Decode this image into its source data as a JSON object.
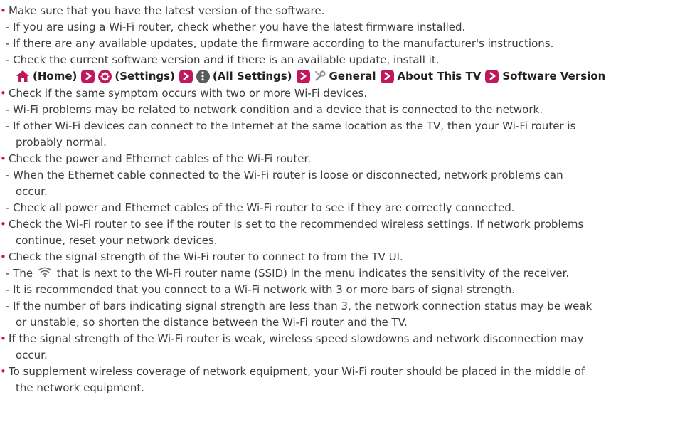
{
  "lines": {
    "l1": "Make sure that you have the latest version of the software.",
    "l2": "- If you are using a Wi-Fi router, check whether you have the latest firmware installed.",
    "l3": "- If there are any available updates, update the firmware according to the manufacturer's instructions.",
    "l4": "- Check the current software version and if there is an available update, install it.",
    "l6": "Check if the same symptom occurs with two or more Wi-Fi devices.",
    "l7": "- Wi-Fi problems may be related to network condition and a device that is connected to the network.",
    "l8": "- If other Wi-Fi devices can connect to the Internet at the same location as the TV, then your Wi-Fi router is",
    "l9": "probably normal.",
    "l10": "Check the power and Ethernet cables of the Wi-Fi router.",
    "l11": "- When the Ethernet cable connected to the Wi-Fi router is loose or disconnected, network problems can",
    "l12": "occur.",
    "l13": "- Check all power and Ethernet cables of the Wi-Fi router to see if they are correctly connected.",
    "l14": "Check the Wi-Fi router to see if the router is set to the recommended wireless settings. If network problems",
    "l15": "continue, reset your network devices.",
    "l16": "Check the signal strength of the Wi-Fi router to connect to from the TV UI.",
    "l17a": "- The ",
    "l17b": " that is next to the Wi-Fi router name (SSID) in the menu indicates the sensitivity of the receiver.",
    "l18": "- It is recommended that you connect to a Wi-Fi network with 3 or more bars of signal strength.",
    "l19": "- If the number of bars indicating signal strength are less than 3, the network connection status may be weak",
    "l20": "or unstable, so shorten the distance between the Wi-Fi router and the TV.",
    "l21": "If the signal strength of the Wi-Fi router is weak, wireless speed slowdowns and network disconnection may",
    "l22": "occur.",
    "l23": "To supplement wireless coverage of network equipment, your Wi-Fi router should be placed in the middle of",
    "l24": "the network equipment."
  },
  "path": {
    "home": "(Home)",
    "settings": "(Settings)",
    "all_settings": "(All Settings)",
    "general": "General",
    "about": "About This TV",
    "software": "Software Version"
  },
  "bullet": "•",
  "accent_color": "#c0185e",
  "icons": [
    "home-icon",
    "settings-icon",
    "all-settings-icon",
    "general-icon",
    "chevron-right-icon",
    "wifi-icon"
  ]
}
